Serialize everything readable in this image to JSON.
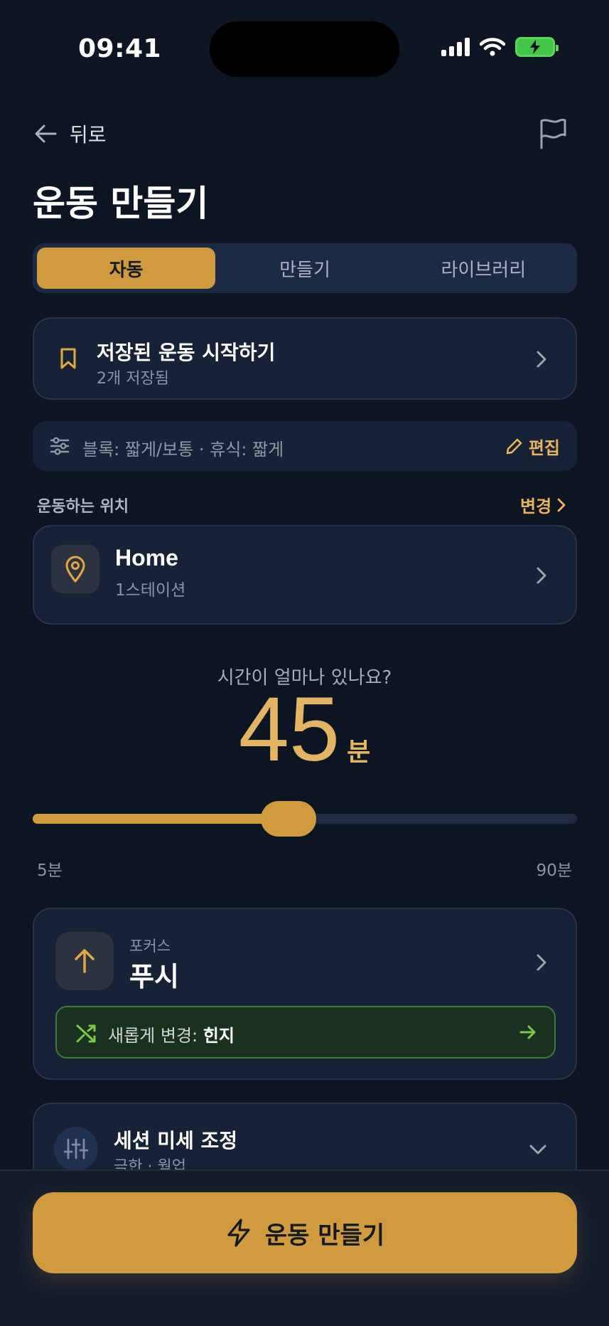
{
  "status_bar": {
    "time": "09:41"
  },
  "header": {
    "back_label": "뒤로",
    "title": "운동 만들기"
  },
  "tabs": [
    {
      "label": "자동",
      "active": true
    },
    {
      "label": "만들기",
      "active": false
    },
    {
      "label": "라이브러리",
      "active": false
    }
  ],
  "saved": {
    "title": "저장된 운동 시작하기",
    "subtitle": "2개 저장됨"
  },
  "filter": {
    "text": "블록: 짧게/보통 · 휴식: 짧게",
    "edit_label": "편집"
  },
  "location": {
    "section_label": "운동하는 위치",
    "change_label": "변경",
    "name": "Home",
    "detail": "1스테이션"
  },
  "duration": {
    "question": "시간이 얼마나 있나요?",
    "value": "45",
    "unit": "분",
    "min_label": "5분",
    "max_label": "90분",
    "min": 5,
    "max": 90,
    "current": 45
  },
  "focus": {
    "label": "포커스",
    "value": "푸시",
    "swap_prefix": "새롭게 변경: ",
    "swap_target": "힌지"
  },
  "tune": {
    "title": "세션 미세 조정",
    "subtitle": "극한 · 웜업"
  },
  "cta": {
    "label": "운동 만들기"
  },
  "colors": {
    "accent": "#d09a3e",
    "background": "#0d1422",
    "card": "#182236",
    "swap_green": "#3f7a37"
  }
}
